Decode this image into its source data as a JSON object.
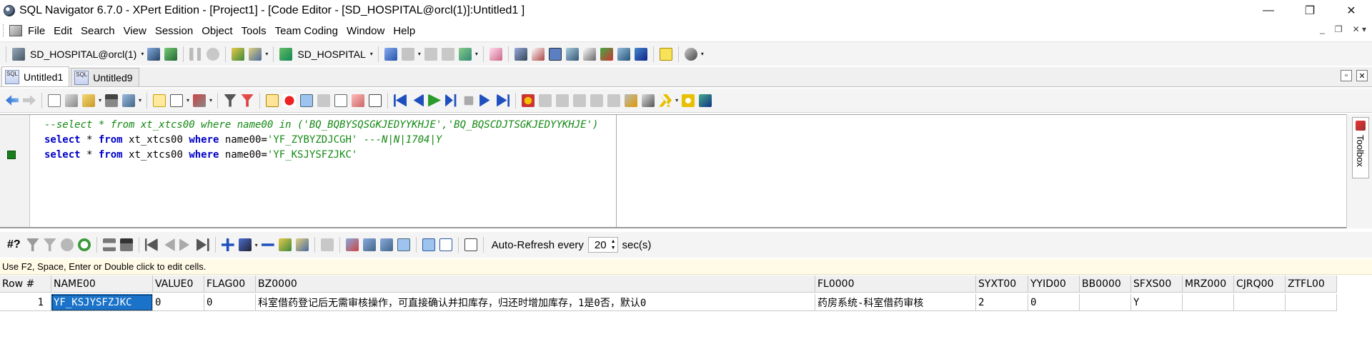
{
  "window": {
    "title": "SQL Navigator 6.7.0 - XPert Edition - [Project1] - [Code Editor - [SD_HOSPITAL@orcl(1)]:Untitled1 ]",
    "minimize": "—",
    "restore": "❐",
    "close": "✕"
  },
  "menu": {
    "items": [
      {
        "name": "menu-file",
        "label": "File"
      },
      {
        "name": "menu-edit",
        "label": "Edit"
      },
      {
        "name": "menu-search",
        "label": "Search"
      },
      {
        "name": "menu-view",
        "label": "View"
      },
      {
        "name": "menu-session",
        "label": "Session"
      },
      {
        "name": "menu-object",
        "label": "Object"
      },
      {
        "name": "menu-tools",
        "label": "Tools"
      },
      {
        "name": "menu-team-coding",
        "label": "Team Coding"
      },
      {
        "name": "menu-window",
        "label": "Window"
      },
      {
        "name": "menu-help",
        "label": "Help"
      }
    ],
    "mdi_min": "_",
    "mdi_restore": "❐",
    "mdi_close": "✕ ▾"
  },
  "toolbar1": {
    "session": "SD_HOSPITAL@orcl(1)",
    "schema": "SD_HOSPITAL"
  },
  "tabs": [
    {
      "label": "Untitled1",
      "icon_text": "SQL"
    },
    {
      "label": "Untitled9",
      "icon_text": "SQL"
    }
  ],
  "tab_controls": {
    "restore": "▫",
    "close": "✕"
  },
  "editor": {
    "line1": "--select * from xt_xtcs00 where name00 in ('BQ_BQBYSQSGKJEDYYKHJE','BQ_BQSCDJTSGKJEDYYKHJE')",
    "line2": {
      "kw1": "select",
      "star": " * ",
      "kw2": "from",
      "tbl": " xt_xtcs00 ",
      "kw3": "where",
      "col": " name00=",
      "val": "'YF_ZYBYZDJCGH'",
      "comment": " ---N|N|1704|Y"
    },
    "line3": {
      "kw1": "select",
      "star": " * ",
      "kw2": "from",
      "tbl": " xt_xtcs00 ",
      "kw3": "where",
      "col": " name00=",
      "val": "'YF_KSJYSFZJKC'"
    }
  },
  "toolbox_label": "Toolbox",
  "results_toolbar": {
    "hash": "#?",
    "auto_refresh_label": "Auto-Refresh every",
    "interval": "20",
    "unit": "sec(s)"
  },
  "hint": "Use F2, Space, Enter or Double click to edit cells.",
  "grid": {
    "columns": [
      "Row #",
      "NAME00",
      "VALUE0",
      "FLAG00",
      "BZ0000",
      "FL0000",
      "SYXT00",
      "YYID00",
      "BB0000",
      "SFXS00",
      "MRZ000",
      "CJRQ00",
      "ZTFL00"
    ],
    "rows": [
      [
        "1",
        "YF_KSJYSFZJKC",
        "0",
        "0",
        "科室借药登记后无需审核操作，可直接确认并扣库存，归还时增加库存，1是0否，默认0",
        "药房系统-科室借药审核",
        "2",
        "0",
        "",
        "Y",
        "",
        "",
        ""
      ]
    ]
  }
}
